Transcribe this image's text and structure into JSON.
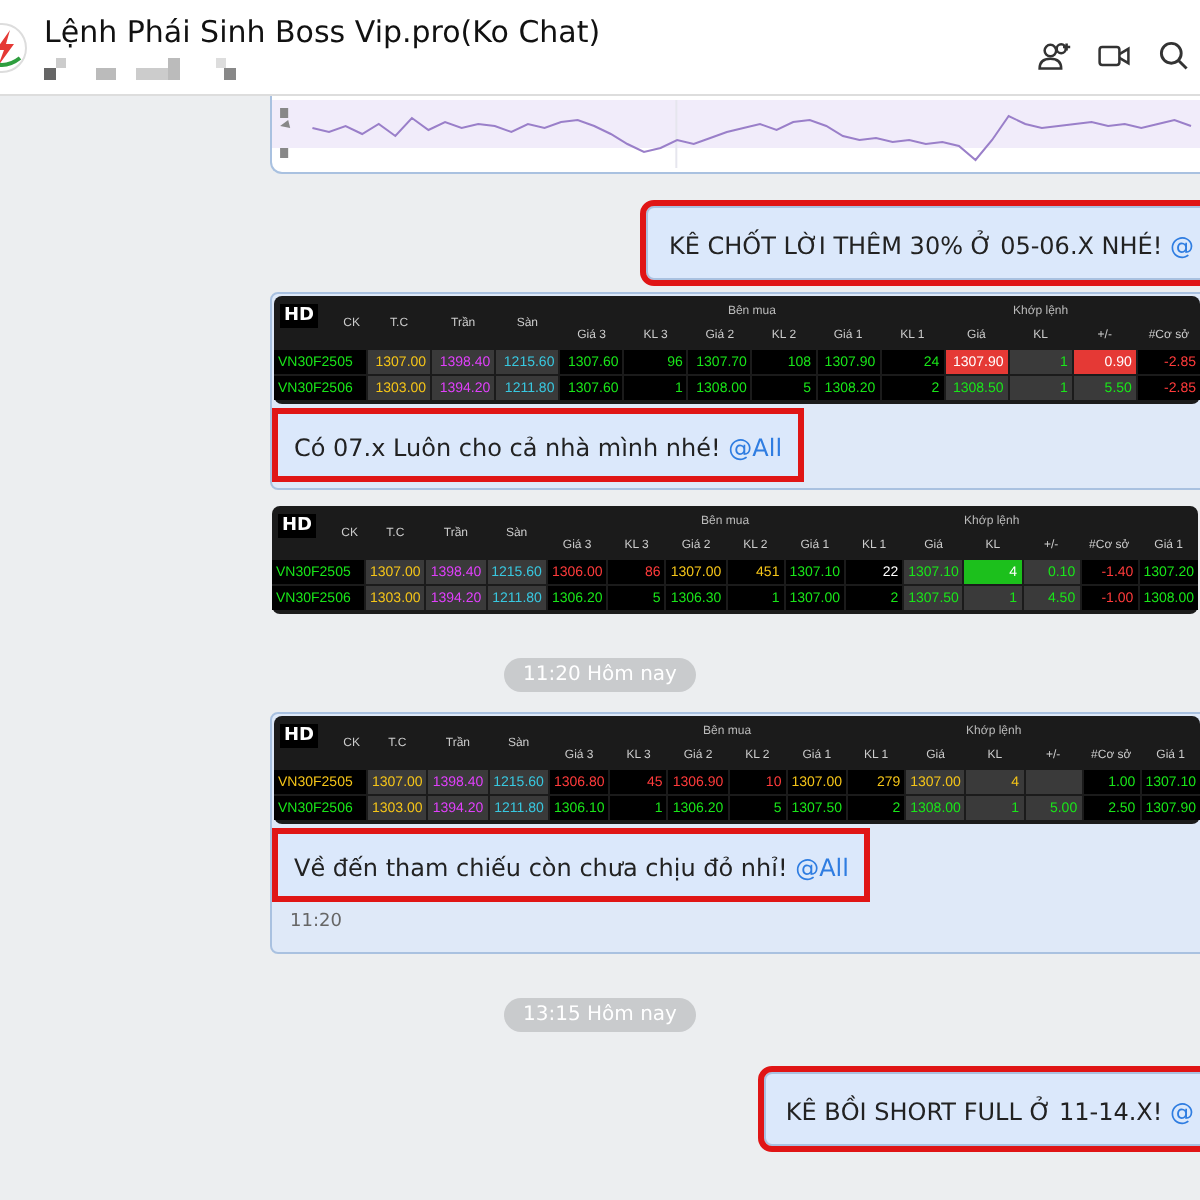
{
  "header": {
    "title": "Lệnh Phái Sinh Boss Vip.pro(Ko Chat)",
    "actions": [
      {
        "kind": "add-member"
      },
      {
        "kind": "video"
      },
      {
        "kind": "search"
      }
    ]
  },
  "messages": [
    {
      "kind": "chart-image"
    },
    {
      "kind": "text",
      "outgoing": true,
      "text": "KÊ CHỐT LỜI THÊM 30% Ở 05-06.X NHÉ!",
      "mention": "@",
      "highlighted": true
    },
    {
      "kind": "table",
      "highlighted": true,
      "text": "Có 07.x Luôn cho cả nhà mình nhé!",
      "mention": "@All",
      "table": {
        "badge": "HD",
        "header": [
          {
            "kind": "tall",
            "label": "CK"
          },
          {
            "kind": "tall",
            "label": "T.C"
          },
          {
            "kind": "tall",
            "label": "Trần"
          },
          {
            "kind": "tall",
            "label": "Sàn"
          },
          {
            "kind": "group",
            "label": "Bên mua",
            "columns": [
              "Giá 3",
              "KL 3",
              "Giá 2",
              "KL 2",
              "Giá 1",
              "KL 1"
            ]
          },
          {
            "kind": "group",
            "label": "Khớp lệnh",
            "columns": [
              "Giá",
              "KL",
              "+/-"
            ]
          },
          {
            "kind": "low",
            "label": "#Cơ sở"
          }
        ],
        "rows": [
          {
            "cells": [
              {
                "text": "VN30F2505",
                "color": "#19e619",
                "kind": "plain"
              },
              {
                "text": "1307.00",
                "color": "#f5c518",
                "kind": "plain"
              },
              {
                "text": "1398.40",
                "color": "#e040fb",
                "kind": "plain"
              },
              {
                "text": "1215.60",
                "color": "#38c8e0",
                "kind": "plain"
              },
              {
                "text": "1307.60",
                "color": "#19e619",
                "kind": "plain"
              },
              {
                "text": "96",
                "color": "#19e619",
                "kind": "plain"
              },
              {
                "text": "1307.70",
                "color": "#19e619",
                "kind": "plain"
              },
              {
                "text": "108",
                "color": "#19e619",
                "kind": "plain"
              },
              {
                "text": "1307.90",
                "color": "#19e619",
                "kind": "plain"
              },
              {
                "text": "24",
                "color": "#19e619",
                "kind": "plain"
              },
              {
                "text": "1307.90",
                "color": "#ffffff",
                "kind": "flash-down"
              },
              {
                "text": "1",
                "color": "#19e619",
                "kind": "plain"
              },
              {
                "text": "0.90",
                "color": "#ffffff",
                "kind": "flash-down"
              },
              {
                "text": "-2.85",
                "color": "#ff3b3b",
                "kind": "plain"
              }
            ]
          },
          {
            "cells": [
              {
                "text": "VN30F2506",
                "color": "#19e619",
                "kind": "plain"
              },
              {
                "text": "1303.00",
                "color": "#f5c518",
                "kind": "plain"
              },
              {
                "text": "1394.20",
                "color": "#e040fb",
                "kind": "plain"
              },
              {
                "text": "1211.80",
                "color": "#38c8e0",
                "kind": "plain"
              },
              {
                "text": "1307.60",
                "color": "#19e619",
                "kind": "plain"
              },
              {
                "text": "1",
                "color": "#19e619",
                "kind": "plain"
              },
              {
                "text": "1308.00",
                "color": "#19e619",
                "kind": "plain"
              },
              {
                "text": "5",
                "color": "#19e619",
                "kind": "plain"
              },
              {
                "text": "1308.20",
                "color": "#19e619",
                "kind": "plain"
              },
              {
                "text": "2",
                "color": "#19e619",
                "kind": "plain"
              },
              {
                "text": "1308.50",
                "color": "#19e619",
                "kind": "plain"
              },
              {
                "text": "1",
                "color": "#19e619",
                "kind": "plain"
              },
              {
                "text": "5.50",
                "color": "#19e619",
                "kind": "plain"
              },
              {
                "text": "-2.85",
                "color": "#ff3b3b",
                "kind": "plain"
              }
            ]
          }
        ]
      }
    },
    {
      "kind": "table",
      "table": {
        "badge": "HD",
        "header": [
          {
            "kind": "tall",
            "label": "CK"
          },
          {
            "kind": "tall",
            "label": "T.C"
          },
          {
            "kind": "tall",
            "label": "Trần"
          },
          {
            "kind": "tall",
            "label": "Sàn"
          },
          {
            "kind": "group",
            "label": "Bên mua",
            "columns": [
              "Giá 3",
              "KL 3",
              "Giá 2",
              "KL 2",
              "Giá 1",
              "KL 1"
            ]
          },
          {
            "kind": "group",
            "label": "Khớp lệnh",
            "columns": [
              "Giá",
              "KL",
              "+/-"
            ]
          },
          {
            "kind": "low",
            "label": "#Cơ sở"
          },
          {
            "kind": "low",
            "label": "Giá 1"
          }
        ],
        "rows": [
          {
            "cells": [
              {
                "text": "VN30F2505",
                "color": "#19e619",
                "kind": "plain"
              },
              {
                "text": "1307.00",
                "color": "#f5c518",
                "kind": "plain"
              },
              {
                "text": "1398.40",
                "color": "#e040fb",
                "kind": "plain"
              },
              {
                "text": "1215.60",
                "color": "#38c8e0",
                "kind": "plain"
              },
              {
                "text": "1306.00",
                "color": "#ff3b3b",
                "kind": "plain"
              },
              {
                "text": "86",
                "color": "#ff3b3b",
                "kind": "plain"
              },
              {
                "text": "1307.00",
                "color": "#f5c518",
                "kind": "plain"
              },
              {
                "text": "451",
                "color": "#f5c518",
                "kind": "plain"
              },
              {
                "text": "1307.10",
                "color": "#19e619",
                "kind": "plain"
              },
              {
                "text": "22",
                "color": "#ffffff",
                "kind": "plain"
              },
              {
                "text": "1307.10",
                "color": "#19e619",
                "kind": "plain"
              },
              {
                "text": "4",
                "color": "#ffffff",
                "kind": "flash-up"
              },
              {
                "text": "0.10",
                "color": "#19e619",
                "kind": "plain"
              },
              {
                "text": "-1.40",
                "color": "#ff3b3b",
                "kind": "plain"
              },
              {
                "text": "1307.20",
                "color": "#19e619",
                "kind": "plain"
              }
            ]
          },
          {
            "cells": [
              {
                "text": "VN30F2506",
                "color": "#19e619",
                "kind": "plain"
              },
              {
                "text": "1303.00",
                "color": "#f5c518",
                "kind": "plain"
              },
              {
                "text": "1394.20",
                "color": "#e040fb",
                "kind": "plain"
              },
              {
                "text": "1211.80",
                "color": "#38c8e0",
                "kind": "plain"
              },
              {
                "text": "1306.20",
                "color": "#19e619",
                "kind": "plain"
              },
              {
                "text": "5",
                "color": "#19e619",
                "kind": "plain"
              },
              {
                "text": "1306.30",
                "color": "#19e619",
                "kind": "plain"
              },
              {
                "text": "1",
                "color": "#19e619",
                "kind": "plain"
              },
              {
                "text": "1307.00",
                "color": "#19e619",
                "kind": "plain"
              },
              {
                "text": "2",
                "color": "#19e619",
                "kind": "plain"
              },
              {
                "text": "1307.50",
                "color": "#19e619",
                "kind": "plain"
              },
              {
                "text": "1",
                "color": "#19e619",
                "kind": "plain"
              },
              {
                "text": "4.50",
                "color": "#19e619",
                "kind": "plain"
              },
              {
                "text": "-1.00",
                "color": "#ff3b3b",
                "kind": "plain"
              },
              {
                "text": "1308.00",
                "color": "#19e619",
                "kind": "plain"
              }
            ]
          }
        ]
      }
    },
    {
      "kind": "date",
      "text": "11:20 Hôm nay"
    },
    {
      "kind": "table",
      "highlighted": true,
      "text": "Về đến tham chiếu còn chưa chịu đỏ nhỉ!",
      "mention": "@All",
      "time": "11:20",
      "table": {
        "badge": "HD",
        "header": [
          {
            "kind": "tall",
            "label": "CK"
          },
          {
            "kind": "tall",
            "label": "T.C"
          },
          {
            "kind": "tall",
            "label": "Trần"
          },
          {
            "kind": "tall",
            "label": "Sàn"
          },
          {
            "kind": "group",
            "label": "Bên mua",
            "columns": [
              "Giá 3",
              "KL 3",
              "Giá 2",
              "KL 2",
              "Giá 1",
              "KL 1"
            ]
          },
          {
            "kind": "group",
            "label": "Khớp lệnh",
            "columns": [
              "Giá",
              "KL",
              "+/-"
            ]
          },
          {
            "kind": "low",
            "label": "#Cơ sở"
          },
          {
            "kind": "low",
            "label": "Giá 1"
          }
        ],
        "rows": [
          {
            "cells": [
              {
                "text": "VN30F2505",
                "color": "#f5c518",
                "kind": "plain"
              },
              {
                "text": "1307.00",
                "color": "#f5c518",
                "kind": "plain"
              },
              {
                "text": "1398.40",
                "color": "#e040fb",
                "kind": "plain"
              },
              {
                "text": "1215.60",
                "color": "#38c8e0",
                "kind": "plain"
              },
              {
                "text": "1306.80",
                "color": "#ff3b3b",
                "kind": "plain"
              },
              {
                "text": "45",
                "color": "#ff3b3b",
                "kind": "plain"
              },
              {
                "text": "1306.90",
                "color": "#ff3b3b",
                "kind": "plain"
              },
              {
                "text": "10",
                "color": "#ff3b3b",
                "kind": "plain"
              },
              {
                "text": "1307.00",
                "color": "#f5c518",
                "kind": "plain"
              },
              {
                "text": "279",
                "color": "#f5c518",
                "kind": "plain"
              },
              {
                "text": "1307.00",
                "color": "#f5c518",
                "kind": "plain"
              },
              {
                "text": "4",
                "color": "#f5c518",
                "kind": "plain"
              },
              {
                "kind": "plain"
              },
              {
                "text": "1.00",
                "color": "#19e619",
                "kind": "plain"
              },
              {
                "text": "1307.10",
                "color": "#19e619",
                "kind": "plain"
              }
            ]
          },
          {
            "cells": [
              {
                "text": "VN30F2506",
                "color": "#19e619",
                "kind": "plain"
              },
              {
                "text": "1303.00",
                "color": "#f5c518",
                "kind": "plain"
              },
              {
                "text": "1394.20",
                "color": "#e040fb",
                "kind": "plain"
              },
              {
                "text": "1211.80",
                "color": "#38c8e0",
                "kind": "plain"
              },
              {
                "text": "1306.10",
                "color": "#19e619",
                "kind": "plain"
              },
              {
                "text": "1",
                "color": "#19e619",
                "kind": "plain"
              },
              {
                "text": "1306.20",
                "color": "#19e619",
                "kind": "plain"
              },
              {
                "text": "5",
                "color": "#19e619",
                "kind": "plain"
              },
              {
                "text": "1307.50",
                "color": "#19e619",
                "kind": "plain"
              },
              {
                "text": "2",
                "color": "#19e619",
                "kind": "plain"
              },
              {
                "text": "1308.00",
                "color": "#19e619",
                "kind": "plain"
              },
              {
                "text": "1",
                "color": "#19e619",
                "kind": "plain"
              },
              {
                "text": "5.00",
                "color": "#19e619",
                "kind": "plain"
              },
              {
                "text": "2.50",
                "color": "#19e619",
                "kind": "plain"
              },
              {
                "text": "1307.90",
                "color": "#19e619",
                "kind": "plain"
              }
            ]
          }
        ]
      }
    },
    {
      "kind": "date",
      "text": "13:15 Hôm nay"
    },
    {
      "kind": "text",
      "outgoing": true,
      "text": "KÊ BỒI SHORT FULL Ở 11-14.X!",
      "mention": "@",
      "highlighted": true
    }
  ]
}
